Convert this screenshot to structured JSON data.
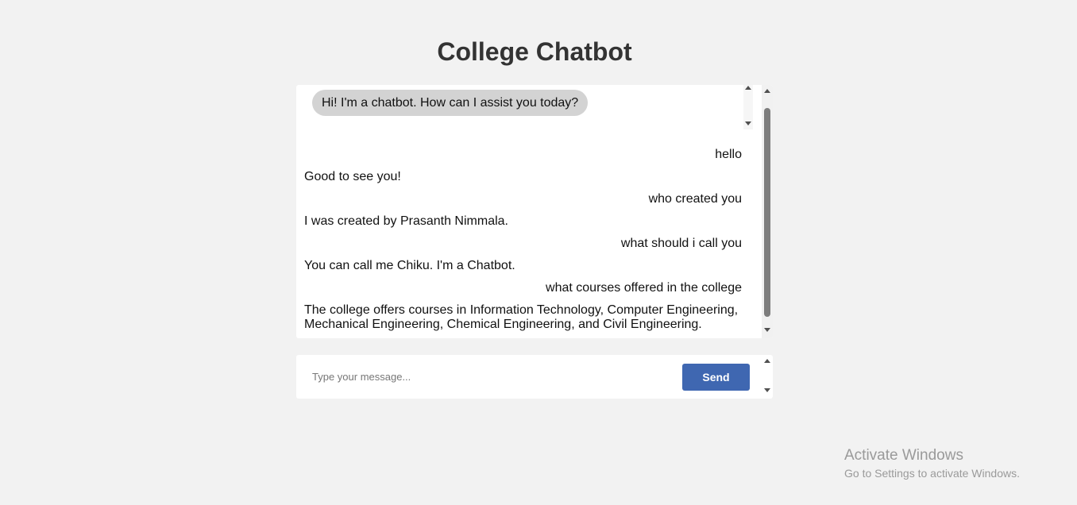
{
  "page_title": "College Chatbot",
  "greeting": "Hi! I'm a chatbot. How can I assist you today?",
  "messages": [
    {
      "sender": "user",
      "text": "hello"
    },
    {
      "sender": "bot",
      "text": "Good to see you!"
    },
    {
      "sender": "user",
      "text": "who created you"
    },
    {
      "sender": "bot",
      "text": "I was created by Prasanth Nimmala."
    },
    {
      "sender": "user",
      "text": "what should i call you"
    },
    {
      "sender": "bot",
      "text": "You can call me Chiku. I'm a Chatbot."
    },
    {
      "sender": "user",
      "text": "what courses offered in the college"
    },
    {
      "sender": "bot",
      "text": "The college offers courses in Information Technology, Computer Engineering, Mechanical Engineering, Chemical Engineering, and Civil Engineering."
    }
  ],
  "input": {
    "placeholder": "Type your message...",
    "value": ""
  },
  "send_label": "Send",
  "watermark": {
    "title": "Activate Windows",
    "subtitle": "Go to Settings to activate Windows."
  },
  "colors": {
    "background": "#f2f2f2",
    "bubble": "#d3d3d3",
    "send_button": "#3f67b1",
    "title": "#333333"
  }
}
